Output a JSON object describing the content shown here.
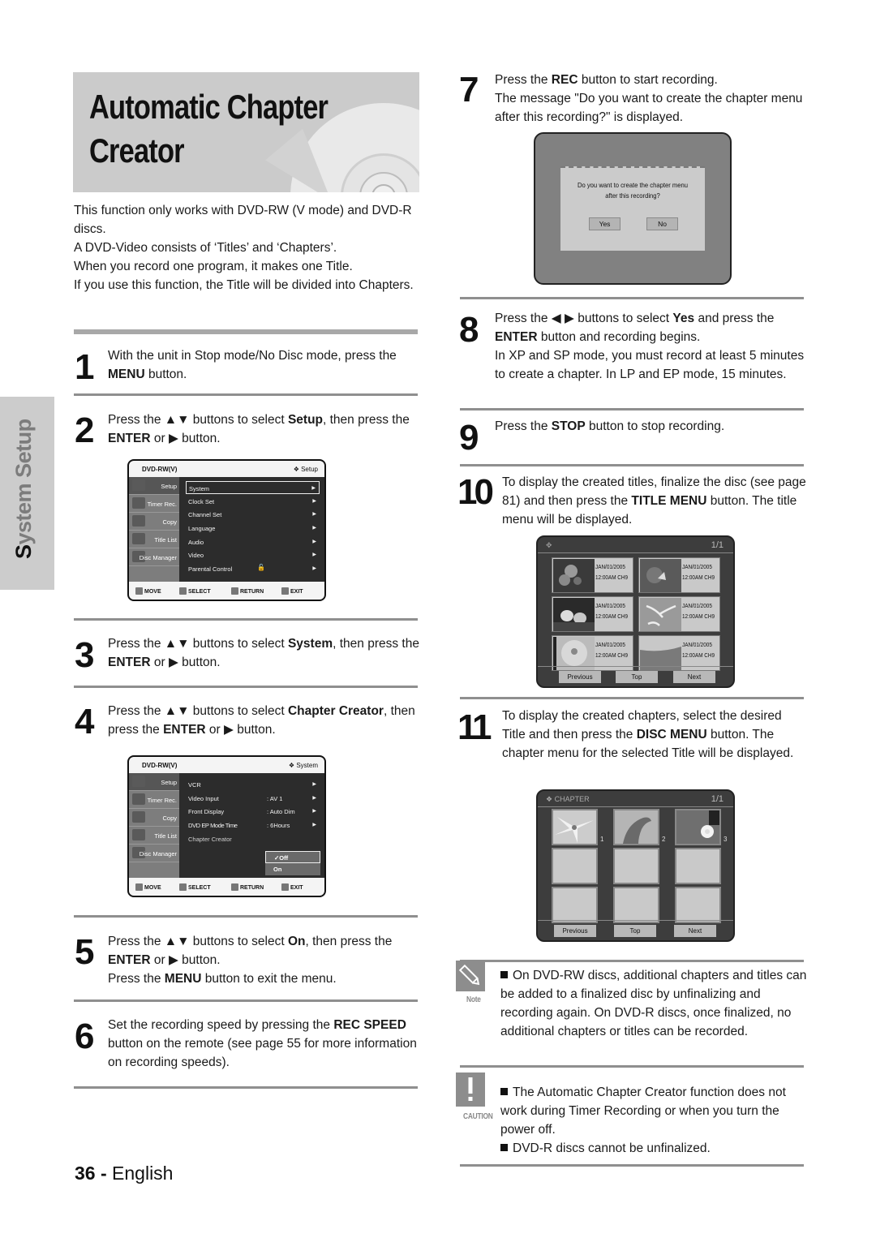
{
  "title": "Automatic Chapter Creator",
  "title_lines": "Automatic Chapter\nCreator",
  "side_tab": {
    "first_letter": "S",
    "rest": "ystem Setup"
  },
  "intro": [
    "This function only works with DVD-RW (V mode) and DVD-R discs.",
    "A DVD-Video consists of ‘Titles’ and ‘Chapters’.",
    "When you record one program, it makes one Title.",
    "If you use this function, the Title will be divided into Chapters."
  ],
  "steps": {
    "s1": {
      "num": "1",
      "html": "With the unit in Stop mode/No Disc mode, press the <b>MENU</b> button."
    },
    "s2": {
      "num": "2",
      "html": "Press the ▲▼ buttons to select <b>Setup</b>, then press the <b>ENTER</b> or ▶ button."
    },
    "s3": {
      "num": "3",
      "html": "Press the ▲▼ buttons to select <b>System</b>, then press the <b>ENTER</b> or ▶ button."
    },
    "s4": {
      "num": "4",
      "html": "Press the ▲▼ buttons to select <b>Chapter Creator</b>, then press the <b>ENTER</b> or ▶ button."
    },
    "s5": {
      "num": "5",
      "html": "Press the ▲▼ buttons to select <b>On</b>, then press the <b>ENTER</b> or ▶ button.<br>Press the <b>MENU</b> button to exit the menu."
    },
    "s6": {
      "num": "6",
      "html": "Set the recording speed by pressing the <b>REC SPEED</b> button on the remote (see page 55 for more information on recording speeds)."
    },
    "s7": {
      "num": "7",
      "html": "Press the <b>REC</b> button to start recording.<br>The message \"Do you want to create the chapter menu after this recording?\" is displayed."
    },
    "s8": {
      "num": "8",
      "html": "Press the ◀ ▶ buttons to select <b>Yes</b> and press the <b>ENTER</b> button and recording begins.<br>In XP and SP mode, you must record at least 5 minutes to create a chapter. In LP and EP mode, 15 minutes."
    },
    "s9": {
      "num": "9",
      "html": "Press the <b>STOP</b> button to stop recording."
    },
    "s10": {
      "num": "10",
      "html": "To display the created titles, finalize the disc (see page 81) and then press the <b>TITLE MENU</b> button. The title menu will be displayed."
    },
    "s11": {
      "num": "11",
      "html": "To display the created chapters, select the desired Title and then press the <b>DISC MENU</b> button. The chapter menu for the selected Title will be displayed."
    }
  },
  "osd1": {
    "disc": "DVD-RW(V)",
    "section": "❖ Setup",
    "side": [
      "Setup",
      "Timer Rec.",
      "Copy",
      "Title List",
      "Disc Manager"
    ],
    "rows": [
      {
        "k": "System",
        "v": "",
        "a": "▶"
      },
      {
        "k": "Clock Set",
        "v": "",
        "a": "▶"
      },
      {
        "k": "Channel Set",
        "v": "",
        "a": "▶"
      },
      {
        "k": "Language",
        "v": "",
        "a": "▶"
      },
      {
        "k": "Audio",
        "v": "",
        "a": "▶"
      },
      {
        "k": "Video",
        "v": "",
        "a": "▶"
      },
      {
        "k": "Parental Control",
        "v": "🔓",
        "a": "▶"
      }
    ],
    "bottom": [
      "MOVE",
      "SELECT",
      "RETURN",
      "EXIT"
    ]
  },
  "osd2": {
    "disc": "DVD-RW(V)",
    "section": "❖ System",
    "side": [
      "Setup",
      "Timer Rec.",
      "Copy",
      "Title List",
      "Disc Manager"
    ],
    "rows": [
      {
        "k": "VCR",
        "v": "",
        "a": "▶"
      },
      {
        "k": "Video Input",
        "v": ": AV 1",
        "a": "▶"
      },
      {
        "k": "Front Display",
        "v": ": Auto Dim",
        "a": "▶"
      },
      {
        "k": "DVD EP Mode Time",
        "v": ": 6Hours",
        "a": "▶"
      },
      {
        "k": "Chapter Creator",
        "v": "",
        "a": ""
      }
    ],
    "dropdown": [
      "✓Off",
      "On"
    ],
    "bottom": [
      "MOVE",
      "SELECT",
      "RETURN",
      "EXIT"
    ]
  },
  "dialog": {
    "message": "Do you  want to create the chapter menu\nafter this recording?",
    "yes": "Yes",
    "no": "No"
  },
  "title_menu": {
    "page": "1/1",
    "items": [
      {
        "date": "JAN/01/2005",
        "time": "12:00AM CH9"
      },
      {
        "date": "JAN/01/2005",
        "time": "12:00AM CH9"
      },
      {
        "date": "JAN/01/2005",
        "time": "12:00AM CH9"
      },
      {
        "date": "JAN/01/2005",
        "time": "12:00AM CH9"
      },
      {
        "date": "JAN/01/2005",
        "time": "12:00AM CH9"
      },
      {
        "date": "JAN/01/2005",
        "time": "12:00AM CH9"
      }
    ],
    "buttons": [
      "Previous",
      "Top",
      "Next"
    ]
  },
  "chapter_menu": {
    "label": "❖ CHAPTER",
    "page": "1/1",
    "numbers": [
      "1",
      "2",
      "3"
    ],
    "buttons": [
      "Previous",
      "Top",
      "Next"
    ]
  },
  "note": {
    "label": "Note",
    "bullets": [
      "On DVD-RW discs, additional chapters and titles can be added to a finalized disc by unfinalizing and recording again. On DVD-R discs, once finalized, no additional chapters or titles can be recorded."
    ]
  },
  "caution": {
    "label": "CAUTION",
    "bullets": [
      "The Automatic Chapter Creator function does not work during Timer Recording or when you turn the power off.",
      "DVD-R discs cannot be unfinalized."
    ]
  },
  "footer": {
    "page": "36 -",
    "lang": "English"
  }
}
